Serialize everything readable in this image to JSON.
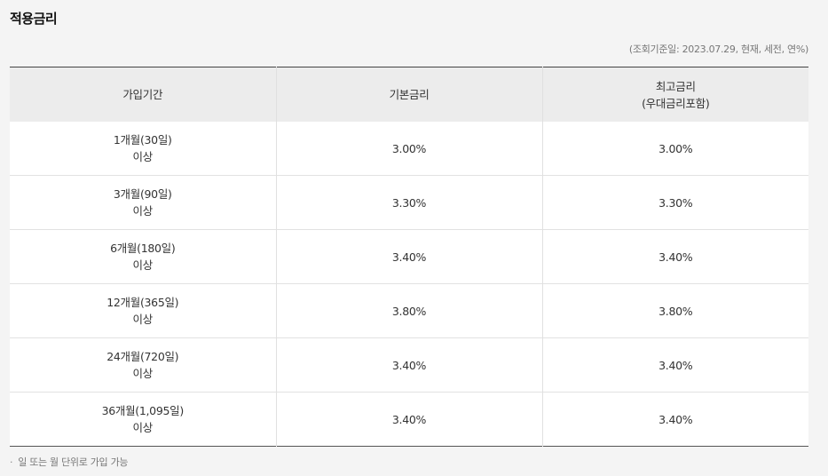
{
  "title": "적용금리",
  "query_info": "(조회기준일: 2023.07.29, 현재, 세전, 연%)",
  "table": {
    "headers": {
      "period": "가입기간",
      "base_rate": "기본금리",
      "max_rate_line1": "최고금리",
      "max_rate_line2": "(우대금리포함)"
    },
    "rows": [
      {
        "period": "1개월(30일)",
        "suffix": "이상",
        "base": "3.00%",
        "max": "3.00%"
      },
      {
        "period": "3개월(90일)",
        "suffix": "이상",
        "base": "3.30%",
        "max": "3.30%"
      },
      {
        "period": "6개월(180일)",
        "suffix": "이상",
        "base": "3.40%",
        "max": "3.40%"
      },
      {
        "period": "12개월(365일)",
        "suffix": "이상",
        "base": "3.80%",
        "max": "3.80%"
      },
      {
        "period": "24개월(720일)",
        "suffix": "이상",
        "base": "3.40%",
        "max": "3.40%"
      },
      {
        "period": "36개월(1,095일)",
        "suffix": "이상",
        "base": "3.40%",
        "max": "3.40%"
      }
    ]
  },
  "note": {
    "bullet": "·",
    "text": "일 또는 월 단위로 가입 가능"
  }
}
